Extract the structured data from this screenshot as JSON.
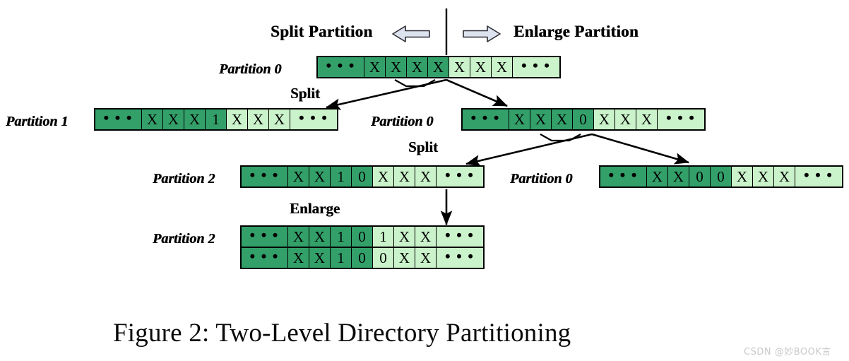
{
  "figure": {
    "caption": "Figure 2: Two-Level Directory Partitioning",
    "watermark": "CSDN @妙BOOK言",
    "colors": {
      "cell_dark_green": "#33a06a",
      "cell_light_green": "#cbf3cb",
      "border": "#000000",
      "banner_arrow_fill": "#dde3ee",
      "background": "#ffffff",
      "watermark": "#c9c9c9"
    }
  },
  "banner": {
    "left_label": "Split Partition",
    "left_arrow_icon": "left-block-arrow",
    "right_arrow_icon": "right-block-arrow",
    "right_label": "Enlarge Partition"
  },
  "operations": {
    "split_1": "Split",
    "split_2": "Split",
    "enlarge": "Enlarge"
  },
  "levels": [
    {
      "id": "level-0",
      "partitions": [
        {
          "id": "l0-p0",
          "label": "Partition 0",
          "rows": [
            {
              "cells": [
                {
                  "text": "…",
                  "kind": "ellipsis",
                  "shade": "dark"
                },
                {
                  "text": "X",
                  "kind": "symbol",
                  "shade": "dark"
                },
                {
                  "text": "X",
                  "kind": "symbol",
                  "shade": "dark"
                },
                {
                  "text": "X",
                  "kind": "symbol",
                  "shade": "dark"
                },
                {
                  "text": "X",
                  "kind": "symbol",
                  "shade": "dark"
                },
                {
                  "text": "X",
                  "kind": "symbol",
                  "shade": "light"
                },
                {
                  "text": "X",
                  "kind": "symbol",
                  "shade": "light"
                },
                {
                  "text": "X",
                  "kind": "symbol",
                  "shade": "light"
                },
                {
                  "text": "…",
                  "kind": "ellipsis",
                  "shade": "light"
                }
              ]
            }
          ]
        }
      ]
    },
    {
      "id": "level-1",
      "partitions": [
        {
          "id": "l1-p1",
          "label": "Partition 1",
          "rows": [
            {
              "cells": [
                {
                  "text": "…",
                  "kind": "ellipsis",
                  "shade": "dark"
                },
                {
                  "text": "X",
                  "kind": "symbol",
                  "shade": "dark"
                },
                {
                  "text": "X",
                  "kind": "symbol",
                  "shade": "dark"
                },
                {
                  "text": "X",
                  "kind": "symbol",
                  "shade": "dark"
                },
                {
                  "text": "1",
                  "kind": "bit",
                  "shade": "dark"
                },
                {
                  "text": "X",
                  "kind": "symbol",
                  "shade": "light"
                },
                {
                  "text": "X",
                  "kind": "symbol",
                  "shade": "light"
                },
                {
                  "text": "X",
                  "kind": "symbol",
                  "shade": "light"
                },
                {
                  "text": "…",
                  "kind": "ellipsis",
                  "shade": "light"
                }
              ]
            }
          ]
        },
        {
          "id": "l1-p0",
          "label": "Partition 0",
          "rows": [
            {
              "cells": [
                {
                  "text": "…",
                  "kind": "ellipsis",
                  "shade": "dark"
                },
                {
                  "text": "X",
                  "kind": "symbol",
                  "shade": "dark"
                },
                {
                  "text": "X",
                  "kind": "symbol",
                  "shade": "dark"
                },
                {
                  "text": "X",
                  "kind": "symbol",
                  "shade": "dark"
                },
                {
                  "text": "0",
                  "kind": "bit",
                  "shade": "dark"
                },
                {
                  "text": "X",
                  "kind": "symbol",
                  "shade": "light"
                },
                {
                  "text": "X",
                  "kind": "symbol",
                  "shade": "light"
                },
                {
                  "text": "X",
                  "kind": "symbol",
                  "shade": "light"
                },
                {
                  "text": "…",
                  "kind": "ellipsis",
                  "shade": "light"
                }
              ]
            }
          ]
        }
      ]
    },
    {
      "id": "level-2",
      "partitions": [
        {
          "id": "l2-p2",
          "label": "Partition 2",
          "rows": [
            {
              "cells": [
                {
                  "text": "…",
                  "kind": "ellipsis",
                  "shade": "dark"
                },
                {
                  "text": "X",
                  "kind": "symbol",
                  "shade": "dark"
                },
                {
                  "text": "X",
                  "kind": "symbol",
                  "shade": "dark"
                },
                {
                  "text": "1",
                  "kind": "bit",
                  "shade": "dark"
                },
                {
                  "text": "0",
                  "kind": "bit",
                  "shade": "dark"
                },
                {
                  "text": "X",
                  "kind": "symbol",
                  "shade": "light"
                },
                {
                  "text": "X",
                  "kind": "symbol",
                  "shade": "light"
                },
                {
                  "text": "X",
                  "kind": "symbol",
                  "shade": "light"
                },
                {
                  "text": "…",
                  "kind": "ellipsis",
                  "shade": "light"
                }
              ]
            }
          ]
        },
        {
          "id": "l2-p0",
          "label": "Partition 0",
          "rows": [
            {
              "cells": [
                {
                  "text": "…",
                  "kind": "ellipsis",
                  "shade": "dark"
                },
                {
                  "text": "X",
                  "kind": "symbol",
                  "shade": "dark"
                },
                {
                  "text": "X",
                  "kind": "symbol",
                  "shade": "dark"
                },
                {
                  "text": "0",
                  "kind": "bit",
                  "shade": "dark"
                },
                {
                  "text": "0",
                  "kind": "bit",
                  "shade": "dark"
                },
                {
                  "text": "X",
                  "kind": "symbol",
                  "shade": "light"
                },
                {
                  "text": "X",
                  "kind": "symbol",
                  "shade": "light"
                },
                {
                  "text": "X",
                  "kind": "symbol",
                  "shade": "light"
                },
                {
                  "text": "…",
                  "kind": "ellipsis",
                  "shade": "light"
                }
              ]
            }
          ]
        }
      ]
    },
    {
      "id": "level-3",
      "partitions": [
        {
          "id": "l3-p2",
          "label": "Partition 2",
          "rows": [
            {
              "cells": [
                {
                  "text": "…",
                  "kind": "ellipsis",
                  "shade": "dark"
                },
                {
                  "text": "X",
                  "kind": "symbol",
                  "shade": "dark"
                },
                {
                  "text": "X",
                  "kind": "symbol",
                  "shade": "dark"
                },
                {
                  "text": "1",
                  "kind": "bit",
                  "shade": "dark"
                },
                {
                  "text": "0",
                  "kind": "bit",
                  "shade": "dark"
                },
                {
                  "text": "1",
                  "kind": "bit",
                  "shade": "light"
                },
                {
                  "text": "X",
                  "kind": "symbol",
                  "shade": "light"
                },
                {
                  "text": "X",
                  "kind": "symbol",
                  "shade": "light"
                },
                {
                  "text": "…",
                  "kind": "ellipsis",
                  "shade": "light"
                }
              ]
            },
            {
              "cells": [
                {
                  "text": "…",
                  "kind": "ellipsis",
                  "shade": "dark"
                },
                {
                  "text": "X",
                  "kind": "symbol",
                  "shade": "dark"
                },
                {
                  "text": "X",
                  "kind": "symbol",
                  "shade": "dark"
                },
                {
                  "text": "1",
                  "kind": "bit",
                  "shade": "dark"
                },
                {
                  "text": "0",
                  "kind": "bit",
                  "shade": "dark"
                },
                {
                  "text": "0",
                  "kind": "bit",
                  "shade": "light"
                },
                {
                  "text": "X",
                  "kind": "symbol",
                  "shade": "light"
                },
                {
                  "text": "X",
                  "kind": "symbol",
                  "shade": "light"
                },
                {
                  "text": "…",
                  "kind": "ellipsis",
                  "shade": "light"
                }
              ]
            }
          ]
        }
      ]
    }
  ]
}
